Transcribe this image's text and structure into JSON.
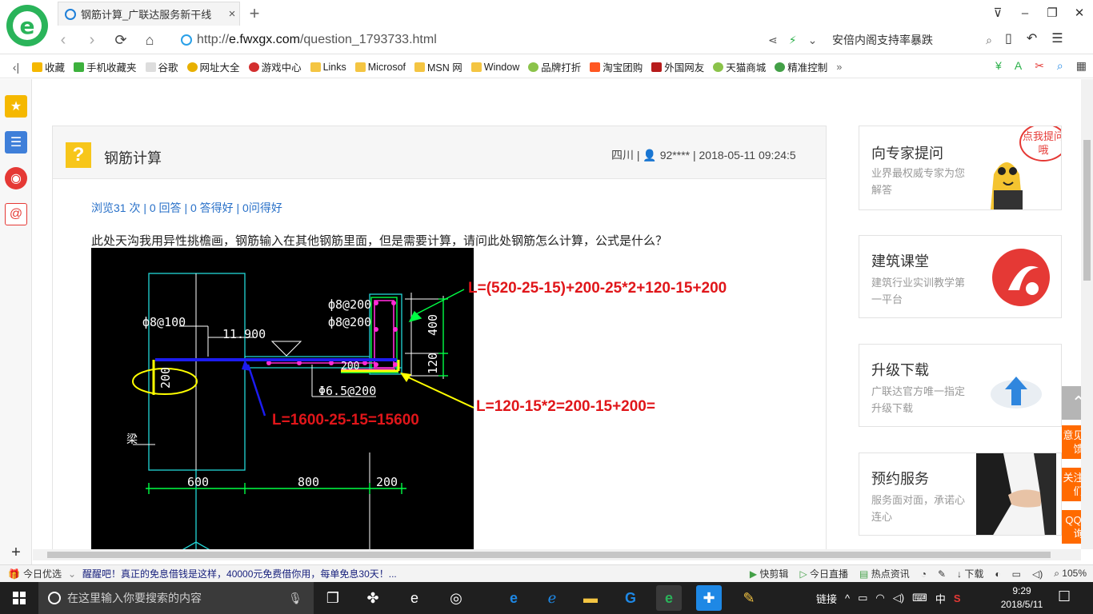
{
  "browser": {
    "tab_title": "钢筋计算_广联达服务新干线",
    "tab_close": "×",
    "new_tab": "+",
    "window_controls": [
      "⊽",
      "–",
      "❐",
      "✕"
    ],
    "url_prefix": "http://",
    "url_domain": "e.fwxgx.com",
    "url_path": "/question_1793733.html",
    "search_text": "安倍内阁支持率暴跌",
    "bookmarks": [
      "收藏",
      "手机收藏夹",
      "谷歌",
      "网址大全",
      "游戏中心",
      "Links",
      "Microsof",
      "MSN 网",
      "Window",
      "品牌打折",
      "淘宝团购",
      "外国网友",
      "天猫商城",
      "精准控制"
    ],
    "bookmark_more": "»"
  },
  "question": {
    "title": "钢筋计算",
    "meta": "四川 | 👤 92**** | 2018-05-11 09:24:5",
    "stats": "浏览31 次 | 0 回答 | 0 答得好 | 0问得好",
    "text": "此处天沟我用异性挑檐画，钢筋输入在其他钢筋里面，但是需要计算，请问此处钢筋怎么计算，公式是什么？"
  },
  "drawing": {
    "labels": {
      "phi8_100": "ф8@100",
      "phi8_200a": "ф8@200",
      "phi8_200b": "ф8@200",
      "elev": "11.900",
      "dim_200_vertical": "200",
      "dim_200_inner": "200",
      "phi65_200": "Φ6.5@200",
      "beam": "梁",
      "dim_400": "400",
      "dim_120": "120",
      "dim_600": "600",
      "dim_800": "800",
      "dim_200_bottom": "200"
    },
    "annotations": {
      "formula_top": "L=(520-25-15)+200-25*2+120-15+200",
      "formula_mid": "L=120-15*2=200-15+200=",
      "formula_bottom": "L=1600-25-15=15600"
    },
    "colors": {
      "annotation_red": "#e0161a",
      "bar_blue": "#1c1cf0",
      "yellow": "#ffff00",
      "green": "#00ff44",
      "magenta": "#ff2bd6",
      "cyan": "#22d7d7"
    }
  },
  "sidebar_cards": [
    {
      "title": "向专家提问",
      "subtitle": "业界最权威专家为您解答",
      "badge": "点我提问哦"
    },
    {
      "title": "建筑课堂",
      "subtitle": "建筑行业实训教学第一平台"
    },
    {
      "title": "升级下载",
      "subtitle": "广联达官方唯一指定升级下载"
    },
    {
      "title": "预约服务",
      "subtitle": "服务面对面，承诺心连心"
    }
  ],
  "float_buttons": [
    "意见反馈",
    "关注我们",
    "QQ咨询"
  ],
  "statusbar": {
    "left_label": "今日优选",
    "news": "醒醒吧！真正的免息借钱是这样，40000元免费借你用，每单免息30天！...",
    "items": [
      "快剪辑",
      "今日直播",
      "热点资讯",
      "下载"
    ],
    "zoom": "105%"
  },
  "taskbar": {
    "search_placeholder": "在这里输入你要搜索的内容",
    "tray_label": "链接",
    "ime": "中",
    "time": "9:29",
    "date": "2018/5/11"
  }
}
